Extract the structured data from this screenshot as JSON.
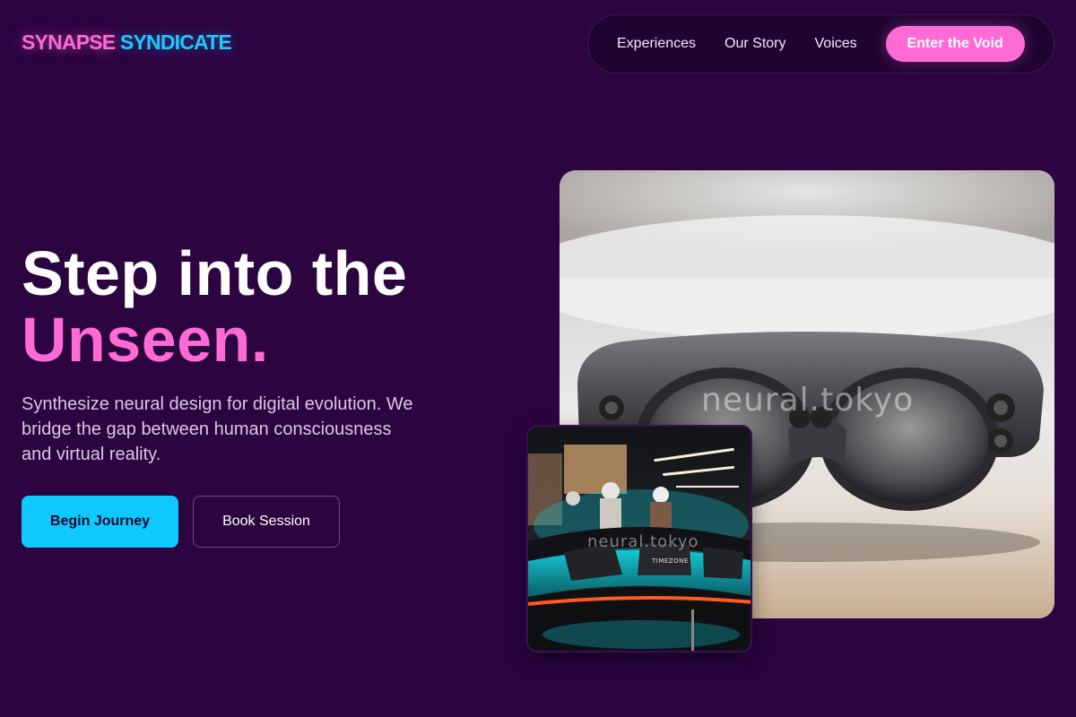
{
  "brand": {
    "part1": "SYNAPSE",
    "part2": "SYNDICATE"
  },
  "nav": {
    "links": [
      "Experiences",
      "Our Story",
      "Voices"
    ],
    "cta": "Enter the Void"
  },
  "hero": {
    "headline_line1": "Step into the",
    "headline_line2": "Unseen.",
    "subtitle": "Synthesize neural design for digital evolution. We bridge the gap between human consciousness and virtual reality.",
    "primary_button": "Begin Journey",
    "secondary_button": "Book Session"
  },
  "images": {
    "main_watermark": "neural.tokyo",
    "inset_watermark": "neural.tokyo",
    "inset_sign": "TIMEZONE"
  },
  "colors": {
    "background": "#2b0440",
    "accent_pink": "#ff6ad5",
    "accent_cyan": "#0fc8ff",
    "nav_bg": "#1f0431"
  }
}
